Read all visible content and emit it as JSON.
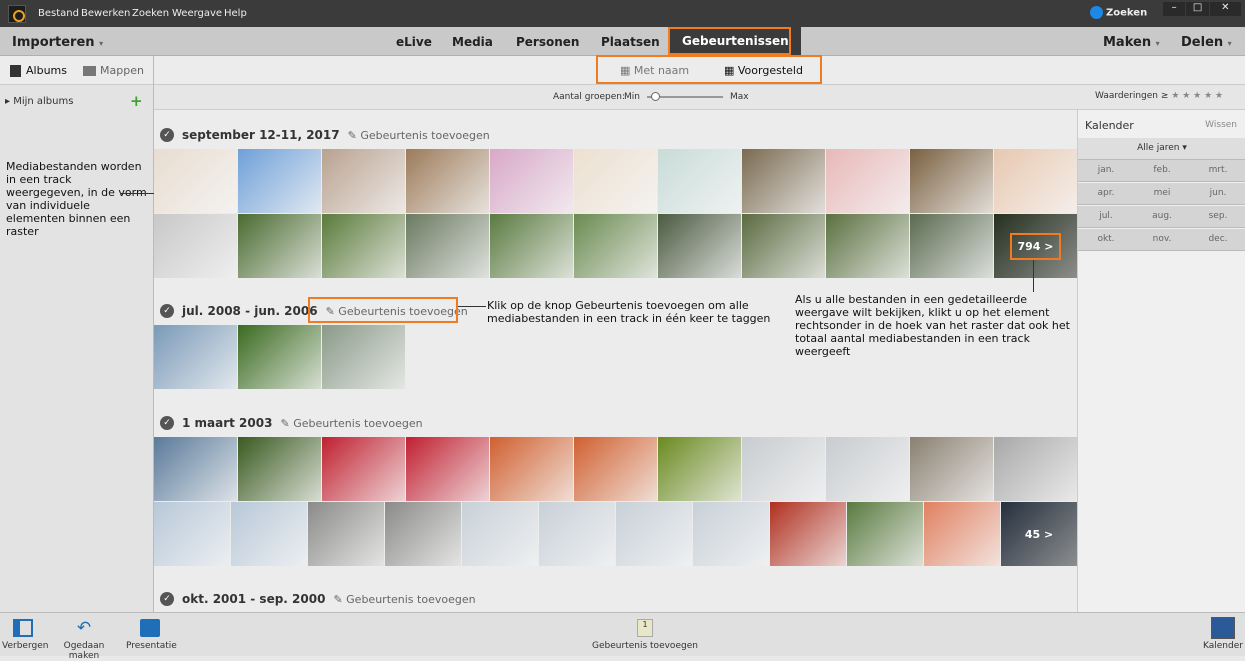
{
  "menu": [
    "Bestand",
    "Bewerken",
    "Zoeken",
    "Weergave",
    "Help"
  ],
  "search_label": "Zoeken",
  "nav": {
    "import": "Importeren",
    "tabs": [
      "eLive",
      "Media",
      "Personen",
      "Plaatsen",
      "Gebeurtenissen"
    ],
    "active": "Gebeurtenissen",
    "make": "Maken",
    "share": "Delen"
  },
  "left": {
    "albums": "Albums",
    "folders": "Mappen",
    "my_albums": "Mijn albums"
  },
  "view": {
    "by_name": "Met naam",
    "suggested": "Voorgesteld"
  },
  "slider": {
    "label": "Aantal groepen:",
    "min": "Min",
    "max": "Max",
    "value": 0.05
  },
  "ratings": {
    "label": "Waarderingen",
    "symbol": "≥",
    "stars": "★ ★ ★ ★ ★"
  },
  "calendar": {
    "title": "Kalender",
    "clear": "Wissen",
    "year": "Alle jaren",
    "months": [
      "jan.",
      "feb.",
      "mrt.",
      "apr.",
      "mei",
      "jun.",
      "jul.",
      "aug.",
      "sep.",
      "okt.",
      "nov.",
      "dec."
    ]
  },
  "add_event": "Gebeurtenis toevoegen",
  "tracks": [
    {
      "title": "september 12-11, 2017",
      "rows": [
        [
          "#e8ddd0",
          "#6fa0d8",
          "#b9a290",
          "#9c7b5a",
          "#d8a8c8",
          "#ece0d0",
          "#c8dcd8",
          "#7a6a50",
          "#e8b8b8",
          "#7a6040",
          "#e8c8b0"
        ],
        [
          "#c8c8c8",
          "#4a6a30",
          "#5a7a3a",
          "#6a7a60",
          "#5a7a40",
          "#6a8a50",
          "#4a5a40",
          "#5a6a40",
          "#5a7040",
          "#5a6a50",
          "#3a4a30"
        ]
      ],
      "more": "794 >"
    },
    {
      "title": "jul. 2008 - jun. 2006",
      "rows": [
        [
          "#7a9ab8",
          "#3a6a20",
          "#8a9a88"
        ]
      ]
    },
    {
      "title": "1 maart 2003",
      "rows": [
        [
          "#5a7a9a",
          "#3a5a20",
          "#c02030",
          "#c02030",
          "#d06030",
          "#d06030",
          "#6a8a20",
          "#c8ccd0",
          "#c8ccd0",
          "#8a8070",
          "#a8a8a8"
        ],
        [
          "#b8c8d8",
          "#b8c8d8",
          "#8a8a88",
          "#8a8a88",
          "#c8d0d8",
          "#c8d0d8",
          "#c8d0d8",
          "#c8d0d8",
          "#b03020",
          "#5a7a40",
          "#e08060",
          "#3a4a60"
        ]
      ],
      "more": "45 >"
    },
    {
      "title": "okt. 2001 - sep. 2000",
      "rows": []
    }
  ],
  "annotations": {
    "left": "Mediabestanden worden in een track weergegeven, in de vorm van individuele elementen binnen een raster",
    "middle": "Klik op de knop Gebeurtenis toevoegen om alle mediabestanden in een track in één keer te taggen",
    "right": "Als u alle bestanden in een gedetailleerde weergave wilt bekijken, klikt u op het element rechtsonder in de hoek van het raster dat ook het totaal aantal mediabestanden in een track weergeeft"
  },
  "bottom": {
    "hide": "Verbergen",
    "undo": "Ogedaan maken",
    "slideshow": "Presentatie",
    "add_event": "Gebeurtenis toevoegen",
    "calendar": "Kalender"
  },
  "colors": {
    "accent": "#f07c22",
    "active_tab": "#3b3b3b",
    "search": "#1e88e5"
  }
}
